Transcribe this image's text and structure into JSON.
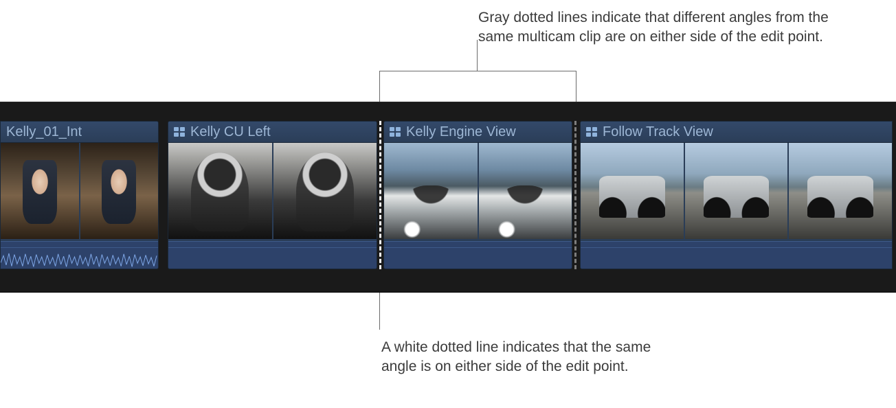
{
  "callouts": {
    "top": "Gray dotted lines indicate that different angles from the same multicam clip are on either side of the edit point.",
    "bottom": "A white dotted line indicates that the same angle is on either side of the edit point."
  },
  "timeline": {
    "clips": [
      {
        "name": "Kelly_01_Int",
        "multicam": false
      },
      {
        "name": "Kelly CU Left",
        "multicam": true
      },
      {
        "name": "Kelly Engine View",
        "multicam": true
      },
      {
        "name": "Follow Track View",
        "multicam": true
      }
    ],
    "edit_points": [
      {
        "position": "between_clip2_clip3",
        "style": "white-dotted",
        "meaning": "same-angle-through-edit"
      },
      {
        "position": "between_clip3_clip4",
        "style": "gray-dotted",
        "meaning": "different-angle-through-edit"
      }
    ]
  },
  "icons": {
    "multicam": "multicam-icon"
  },
  "colors": {
    "clip_bg": "#2a3d57",
    "clip_title": "#9db6d4",
    "timeline_bg": "#1a1a1a",
    "white_dotted": "#f5f5f5",
    "gray_dotted": "#7e7e7e"
  }
}
